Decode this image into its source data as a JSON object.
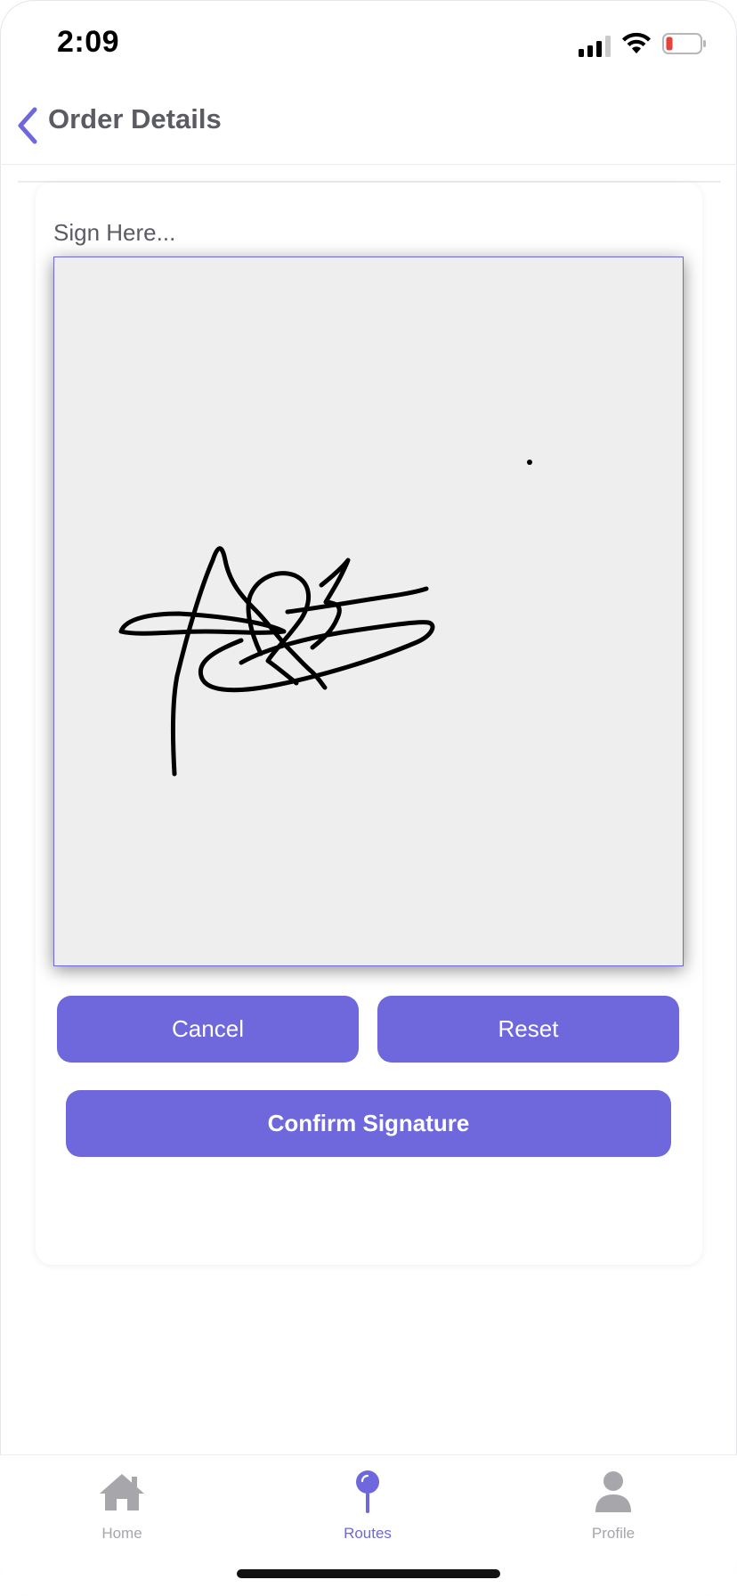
{
  "status_bar": {
    "time": "2:09",
    "icons": [
      "cellular-signal-icon",
      "wifi-icon",
      "battery-low-icon"
    ]
  },
  "header": {
    "back_icon": "chevron-left-icon",
    "title": "Order Details"
  },
  "signature": {
    "label": "Sign Here...",
    "has_signature": true
  },
  "buttons": {
    "cancel": "Cancel",
    "reset": "Reset",
    "confirm": "Confirm Signature"
  },
  "tab_bar": {
    "active": "Routes",
    "tabs": [
      {
        "label": "Home",
        "icon": "home-icon"
      },
      {
        "label": "Routes",
        "icon": "map-pin-icon"
      },
      {
        "label": "Profile",
        "icon": "person-icon"
      }
    ]
  },
  "colors": {
    "accent": "#6e68dc",
    "inactive": "#a6a6ab",
    "pad_background": "#eeeeef",
    "battery_low": "#e5423b"
  }
}
